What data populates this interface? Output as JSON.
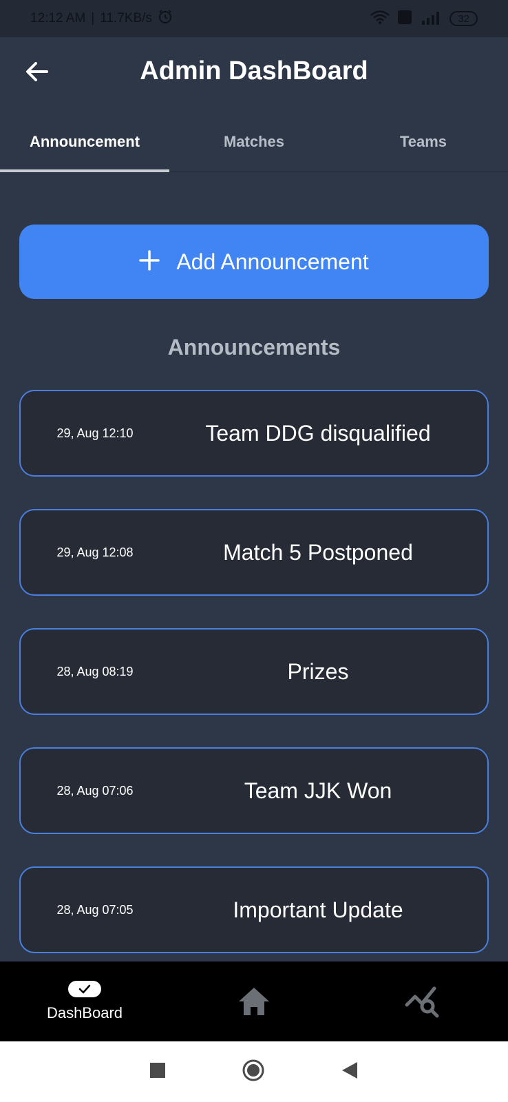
{
  "status_bar": {
    "time": "12:12 AM",
    "separator": "|",
    "speed": "11.7KB/s",
    "battery": "32"
  },
  "app_bar": {
    "title": "Admin DashBoard"
  },
  "tabs": [
    {
      "label": "Announcement",
      "active": true
    },
    {
      "label": "Matches",
      "active": false
    },
    {
      "label": "Teams",
      "active": false
    }
  ],
  "add_button": {
    "label": "Add Announcement"
  },
  "section": {
    "title": "Announcements"
  },
  "announcements": [
    {
      "date": "29, Aug 12:10",
      "title": "Team DDG disqualified"
    },
    {
      "date": "29, Aug 12:08",
      "title": "Match 5 Postponed"
    },
    {
      "date": "28, Aug 08:19",
      "title": "Prizes"
    },
    {
      "date": "28, Aug 07:06",
      "title": "Team JJK Won"
    },
    {
      "date": "28, Aug 07:05",
      "title": "Important Update"
    }
  ],
  "bottom_nav": {
    "items": [
      {
        "label": "DashBoard",
        "icon": "check-pill-icon"
      },
      {
        "icon": "home-icon"
      },
      {
        "icon": "chart-search-icon"
      }
    ]
  },
  "colors": {
    "background": "#2d3748",
    "accent": "#4185f4",
    "card_border": "#4a7fe0"
  }
}
